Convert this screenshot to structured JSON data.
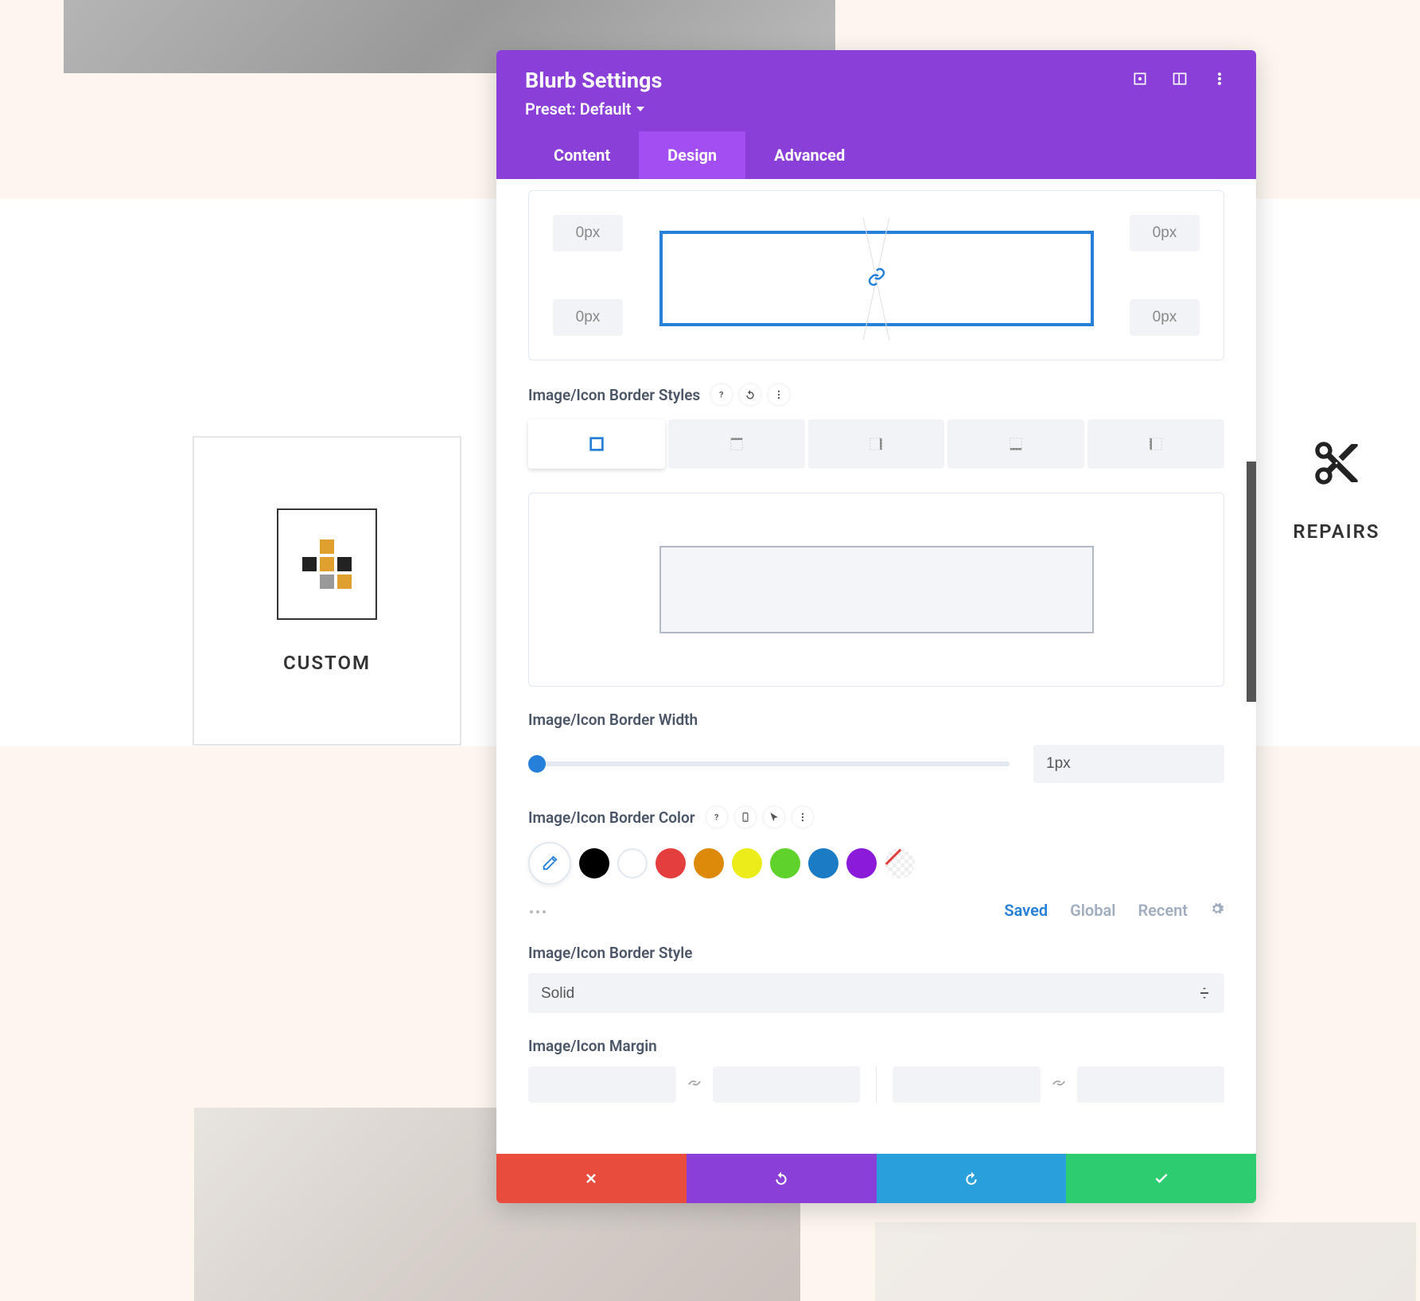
{
  "modal": {
    "title": "Blurb Settings",
    "preset": "Preset: Default",
    "tabs": {
      "content": "Content",
      "design": "Design",
      "advanced": "Advanced"
    }
  },
  "corners": {
    "tl": "0px",
    "tr": "0px",
    "bl": "0px",
    "br": "0px"
  },
  "labels": {
    "border_styles": "Image/Icon Border Styles",
    "border_width": "Image/Icon Border Width",
    "border_color": "Image/Icon Border Color",
    "border_style": "Image/Icon Border Style",
    "margin": "Image/Icon Margin"
  },
  "border_width_value": "1px",
  "border_style_value": "Solid",
  "color_tabs": {
    "saved": "Saved",
    "global": "Global",
    "recent": "Recent"
  },
  "swatches": [
    "#000000",
    "#ffffff",
    "#e53e3e",
    "#dd8a0b",
    "#ecec1a",
    "#5fd32b",
    "#1b7bc4",
    "#8b1bd9"
  ],
  "background_cards": {
    "custom": "CUSTOM",
    "repairs": "REPAIRS"
  }
}
